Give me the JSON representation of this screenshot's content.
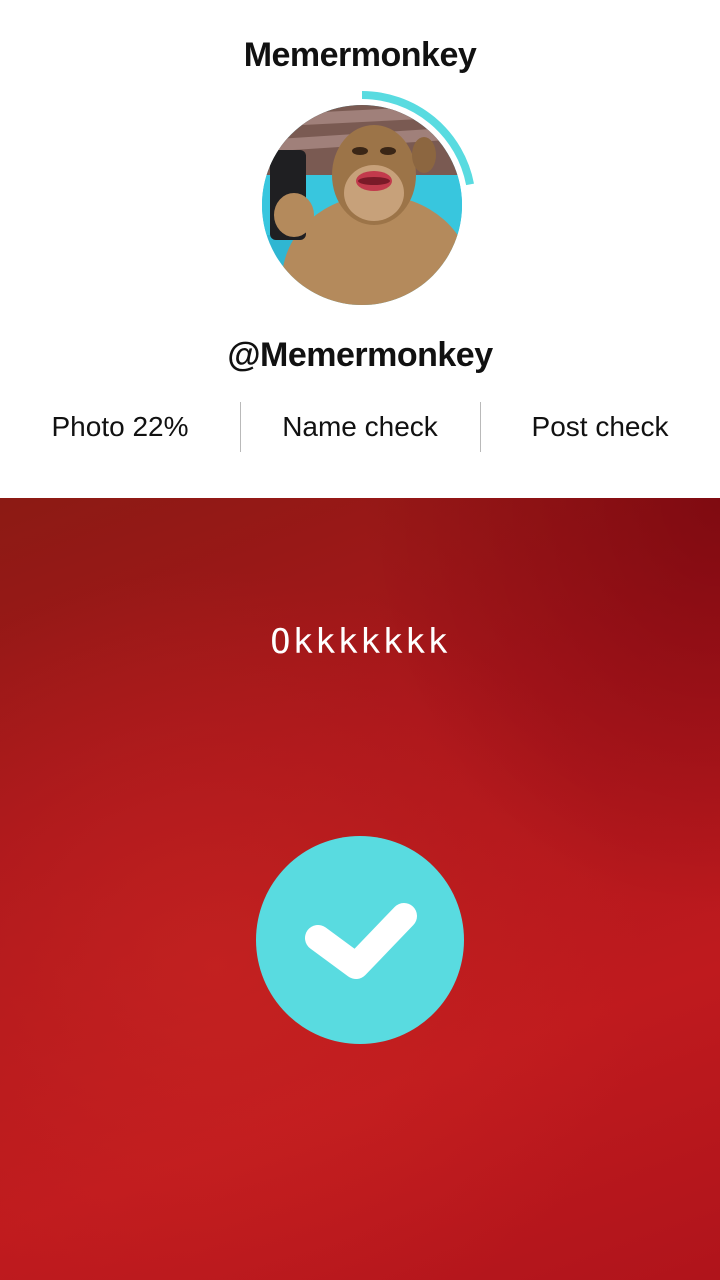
{
  "profile": {
    "title": "Memermonkey",
    "handle": "@Memermonkey",
    "photo_progress": 0.22
  },
  "checks": [
    {
      "label": "Photo 22%"
    },
    {
      "label": "Name check"
    },
    {
      "label": "Post check"
    }
  ],
  "result": {
    "caption": "Okkkkkkk",
    "check_icon": "checkmark-icon"
  },
  "colors": {
    "accent": "#59dbe0",
    "panel_red": "#b3161b",
    "text": "#111111"
  }
}
